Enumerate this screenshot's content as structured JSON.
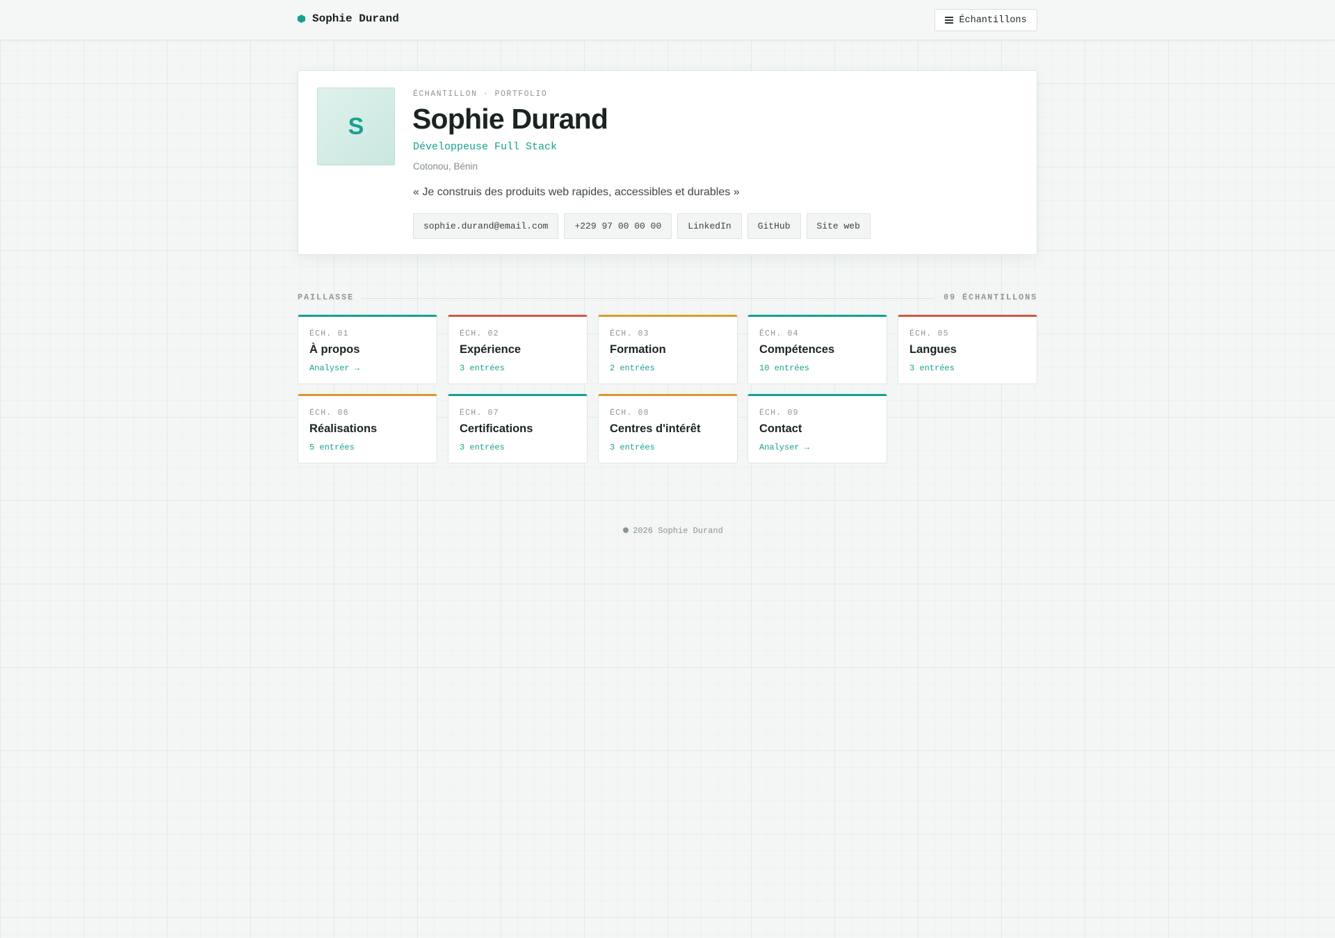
{
  "header": {
    "brand": "Sophie Durand",
    "menu_label": "Échantillons"
  },
  "profile": {
    "avatar_initial": "S",
    "eyebrow": "ÉCHANTILLON · PORTFOLIO",
    "name": "Sophie Durand",
    "role": "Développeuse Full Stack",
    "location": "Cotonou, Bénin",
    "quote": "« Je construis des produits web rapides, accessibles et durables »",
    "links": {
      "email": "sophie.durand@email.com",
      "phone": "+229 97 00 00 00",
      "linkedin": "LinkedIn",
      "github": "GitHub",
      "website": "Site web"
    }
  },
  "section": {
    "label": "PAILLASSE",
    "count": "09 ÉCHANTILLONS"
  },
  "samples": [
    {
      "num": "ÉCH. 01",
      "title": "À propos",
      "sub": "Analyser →"
    },
    {
      "num": "ÉCH. 02",
      "title": "Expérience",
      "sub": "3 entrées"
    },
    {
      "num": "ÉCH. 03",
      "title": "Formation",
      "sub": "2 entrées"
    },
    {
      "num": "ÉCH. 04",
      "title": "Compétences",
      "sub": "10 entrées"
    },
    {
      "num": "ÉCH. 05",
      "title": "Langues",
      "sub": "3 entrées"
    },
    {
      "num": "ÉCH. 06",
      "title": "Réalisations",
      "sub": "5 entrées"
    },
    {
      "num": "ÉCH. 07",
      "title": "Certifications",
      "sub": "3 entrées"
    },
    {
      "num": "ÉCH. 08",
      "title": "Centres d'intérêt",
      "sub": "3 entrées"
    },
    {
      "num": "ÉCH. 09",
      "title": "Contact",
      "sub": "Analyser →"
    }
  ],
  "footer": {
    "text": "2026 Sophie Durand"
  },
  "colors": {
    "accent": "#17a08e",
    "red": "#d2563e",
    "amber": "#d89a2a"
  }
}
